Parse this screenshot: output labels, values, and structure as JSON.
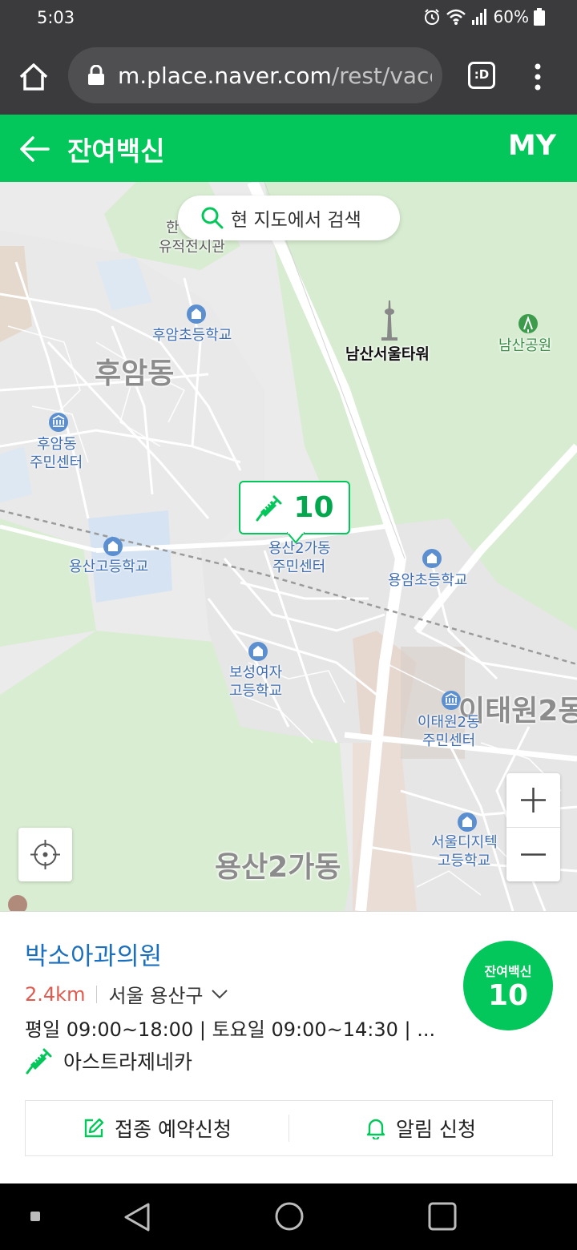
{
  "status_bar": {
    "time": "5:03",
    "battery": "60%"
  },
  "browser": {
    "url_host": "m.place.naver.com",
    "url_path": "/rest/vacc",
    "tabs_label": ":D"
  },
  "header": {
    "title": "잔여백신",
    "my_label": "MY"
  },
  "map": {
    "search_button": "현 지도에서 검색",
    "marker_count": "10",
    "labels": {
      "hangul_museum_1": "한",
      "hangul_museum_2": "유적전시관",
      "huam_elem": "후암초등학교",
      "huam_dong": "후암동",
      "namsan_tower": "남산서울타워",
      "namsan_park": "남산공원",
      "huam_center_1": "후암동",
      "huam_center_2": "주민센터",
      "yongsan_high": "용산고등학교",
      "yongsan2_center_1": "용산2가동",
      "yongsan2_center_2": "주민센터",
      "yongam_elem": "용암초등학교",
      "boseong_1": "보성여자",
      "boseong_2": "고등학교",
      "itaewon2_big": "이태원2동",
      "itaewon2_center_1": "이태원2동",
      "itaewon2_center_2": "주민센터",
      "seoul_digital_1": "서울디지텍",
      "seoul_digital_2": "고등학교",
      "yongsan2_big": "용산2가동"
    }
  },
  "place": {
    "name": "박소아과의원",
    "distance": "2.4km",
    "address": "서울 용산구",
    "hours": "평일 09:00~18:00 | 토요일 09:00~14:30 | ...",
    "vaccine": "아스트라제네카",
    "badge_label": "잔여백신",
    "badge_count": "10",
    "reserve_button": "접종 예약신청",
    "notify_button": "알림 신청"
  },
  "colors": {
    "brand_green": "#03c75a",
    "link_blue": "#1a6fbf",
    "distance_red": "#e05a4f"
  }
}
